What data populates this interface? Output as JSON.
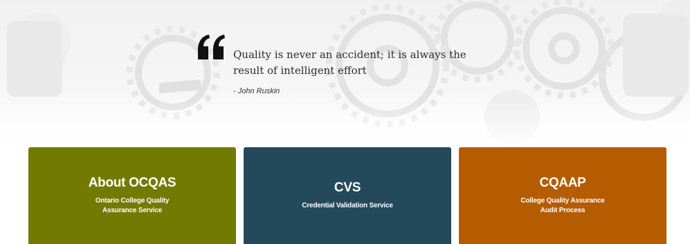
{
  "quote": {
    "text": "Quality is never an accident; it is always the result of intelligent effort",
    "author": "- John Ruskin"
  },
  "cards": [
    {
      "title": "About OCQAS",
      "subtitle": "Ontario College Quality Assurance Service",
      "color": "#727a02"
    },
    {
      "title": "CVS",
      "subtitle": "Credential Validation Service",
      "color": "#24495a"
    },
    {
      "title": "CQAAP",
      "subtitle": "College Quality Assurance Audit Process",
      "color": "#b55b00"
    }
  ],
  "icons": {
    "quote": "quote-icon",
    "background": "gears-background"
  }
}
